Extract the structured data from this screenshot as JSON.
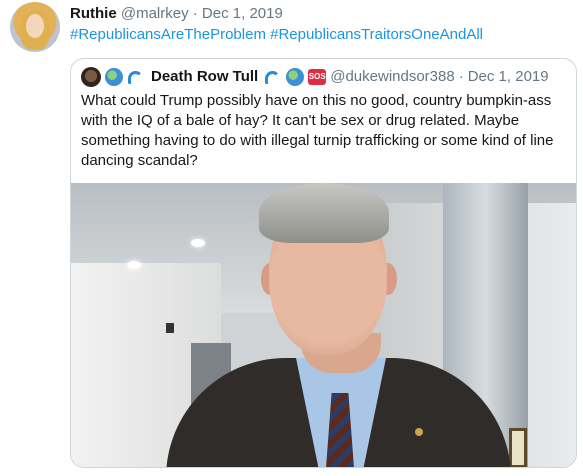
{
  "tweet": {
    "user": {
      "name": "Ruthie",
      "handle": "@malrkey",
      "separator": "·",
      "date": "Dec 1, 2019"
    },
    "hashtags": [
      "#RepublicansAreTheProblem",
      "#RepublicansTraitorsOneAndAll"
    ]
  },
  "quote": {
    "user": {
      "name": "Death Row Tull",
      "handle": "@dukewindsor388",
      "separator": "·",
      "date": "Dec 1, 2019",
      "emojis_before": [
        "globe-emoji",
        "wave-emoji"
      ],
      "emojis_after": [
        "wave-emoji",
        "globe-emoji",
        "sos-emoji"
      ],
      "sos_label": "SOS"
    },
    "text_lines": [
      "What could Trump possibly have on this no good, country bumpkin-ass",
      "with the IQ of a bale of hay?  It can't be sex or drug related. Maybe",
      "something having to do with illegal turnip trafficking or some kind of line",
      "dancing scandal?"
    ]
  },
  "colors": {
    "link": "#1b95e0",
    "muted": "#657786",
    "text": "#14171a",
    "border": "#ccd6dd"
  }
}
